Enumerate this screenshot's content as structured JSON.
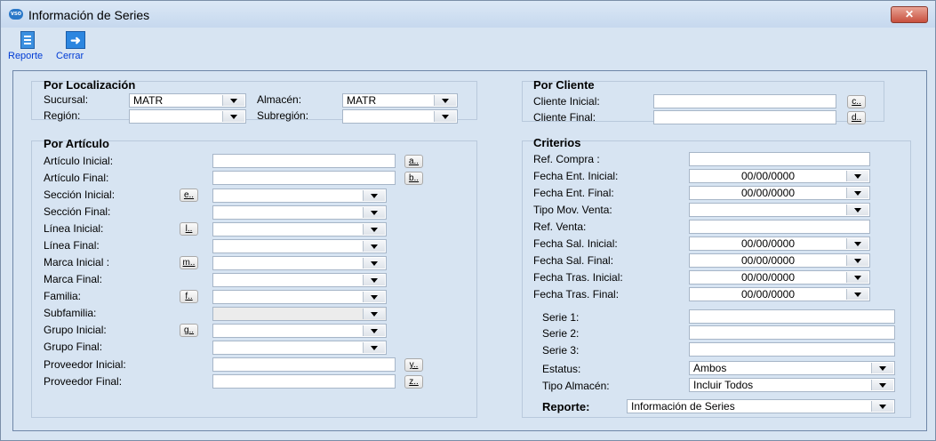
{
  "window": {
    "title": "Información de Series",
    "icon_text": "vso",
    "close_label": "✕"
  },
  "toolbar": {
    "report_label": "Reporte",
    "close_label": "Cerrar"
  },
  "localizacion": {
    "title": "Por Localización",
    "sucursal": {
      "label": "Sucursal:",
      "value": "MATR"
    },
    "almacen": {
      "label": "Almacén:",
      "value": "MATR"
    },
    "region": {
      "label": "Región:",
      "value": ""
    },
    "subregion": {
      "label": "Subregión:",
      "value": ""
    }
  },
  "cliente": {
    "title": "Por Cliente",
    "inicial": {
      "label": "Cliente Inicial:",
      "value": "",
      "button": "c.."
    },
    "final": {
      "label": "Cliente Final:",
      "value": "",
      "button": "d.."
    }
  },
  "articulo": {
    "title": "Por Artículo",
    "articulo_inicial": {
      "label": "Artículo Inicial:",
      "button": "a..",
      "value": ""
    },
    "articulo_final": {
      "label": "Artículo Final:",
      "button": "b..",
      "value": ""
    },
    "seccion_inicial": {
      "label": "Sección Inicial:",
      "button": "e..",
      "value": ""
    },
    "seccion_final": {
      "label": "Sección Final:",
      "value": ""
    },
    "linea_inicial": {
      "label": "Línea Inicial:",
      "button": "l..",
      "value": ""
    },
    "linea_final": {
      "label": "Línea Final:",
      "value": ""
    },
    "marca_inicial": {
      "label": "Marca Inicial :",
      "button": "m..",
      "value": ""
    },
    "marca_final": {
      "label": "Marca Final:",
      "value": ""
    },
    "familia": {
      "label": "Familia:",
      "button": "f..",
      "value": ""
    },
    "subfamilia": {
      "label": "Subfamilia:",
      "value": ""
    },
    "grupo_inicial": {
      "label": "Grupo Inicial:",
      "button": "g..",
      "value": ""
    },
    "grupo_final": {
      "label": "Grupo Final:",
      "value": ""
    },
    "proveedor_inicial": {
      "label": "Proveedor Inicial:",
      "button": "y..",
      "value": ""
    },
    "proveedor_final": {
      "label": "Proveedor Final:",
      "button": "z..",
      "value": ""
    }
  },
  "criterios": {
    "title": "Criterios",
    "ref_compra": {
      "label": "Ref. Compra :",
      "value": ""
    },
    "fecha_ent_inicial": {
      "label": "Fecha Ent. Inicial:",
      "value": "00/00/0000"
    },
    "fecha_ent_final": {
      "label": "Fecha Ent. Final:",
      "value": "00/00/0000"
    },
    "tipo_mov_venta": {
      "label": "Tipo Mov. Venta:",
      "value": ""
    },
    "ref_venta": {
      "label": "Ref. Venta:",
      "value": ""
    },
    "fecha_sal_inicial": {
      "label": "Fecha Sal. Inicial:",
      "value": "00/00/0000"
    },
    "fecha_sal_final": {
      "label": "Fecha Sal. Final:",
      "value": "00/00/0000"
    },
    "fecha_tras_inicial": {
      "label": "Fecha Tras. Inicial:",
      "value": "00/00/0000"
    },
    "fecha_tras_final": {
      "label": "Fecha Tras. Final:",
      "value": "00/00/0000"
    },
    "serie1": {
      "label": "Serie 1:",
      "value": ""
    },
    "serie2": {
      "label": "Serie 2:",
      "value": ""
    },
    "serie3": {
      "label": "Serie 3:",
      "value": ""
    },
    "estatus": {
      "label": "Estatus:",
      "value": "Ambos"
    },
    "tipo_almacen": {
      "label": "Tipo Almacén:",
      "value": "Incluir Todos"
    },
    "reporte": {
      "label": "Reporte:",
      "value": "Información de Series"
    }
  },
  "icons": [
    "app-logo-icon",
    "report-document-icon",
    "exit-arrow-icon",
    "dropdown-arrow-icon"
  ]
}
